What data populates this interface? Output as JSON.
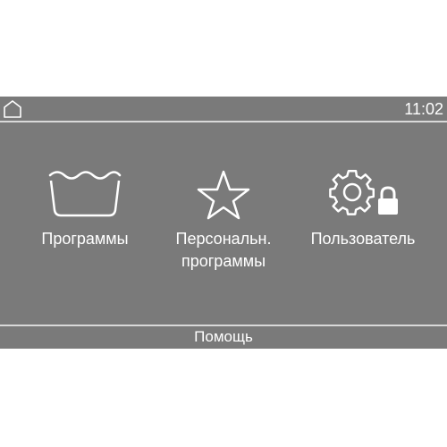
{
  "status_bar": {
    "home_icon": "home-icon",
    "time": "11:02"
  },
  "menu": {
    "items": [
      {
        "icon": "wash-basin-icon",
        "label_lines": [
          "Программы"
        ]
      },
      {
        "icon": "star-icon",
        "label_lines": [
          "Персональн.",
          "программы"
        ]
      },
      {
        "icon": "gear-lock-icon",
        "label_lines": [
          "Пользователь"
        ]
      }
    ]
  },
  "footer": {
    "help_label": "Помощь"
  },
  "colors": {
    "screen_background": "#7a7a7a",
    "foreground": "#ffffff",
    "divider": "#d9d9d9"
  }
}
